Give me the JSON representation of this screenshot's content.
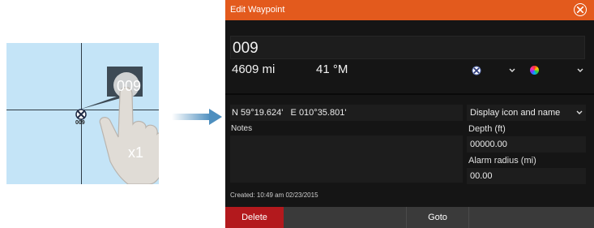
{
  "illustration": {
    "waypoint_label": "009",
    "popup_label": "009",
    "tap_count": "x1"
  },
  "dialog": {
    "title": "Edit Waypoint",
    "name": "009",
    "distance": "4609 mi",
    "bearing": "41 °M",
    "icon_select_icon": "waypoint-marker-icon",
    "color_select_icon": "color-wheel-icon",
    "position": "N 59°19.624'   E 010°35.801'",
    "display_mode": "Display icon and name",
    "notes_label": "Notes",
    "notes_value": "",
    "depth_label": "Depth (ft)",
    "depth_value": "00000.00",
    "alarm_label": "Alarm radius (mi)",
    "alarm_value": "00.00",
    "created": "Created: 10:49 am  02/23/2015",
    "buttons": {
      "delete": "Delete",
      "goto": "Goto"
    }
  },
  "colors": {
    "titlebar": "#e35a1d",
    "delete": "#b3191d",
    "dialog_bg": "#151515",
    "field_bg": "#1d1d1d",
    "map_water": "#c4e4f7"
  }
}
